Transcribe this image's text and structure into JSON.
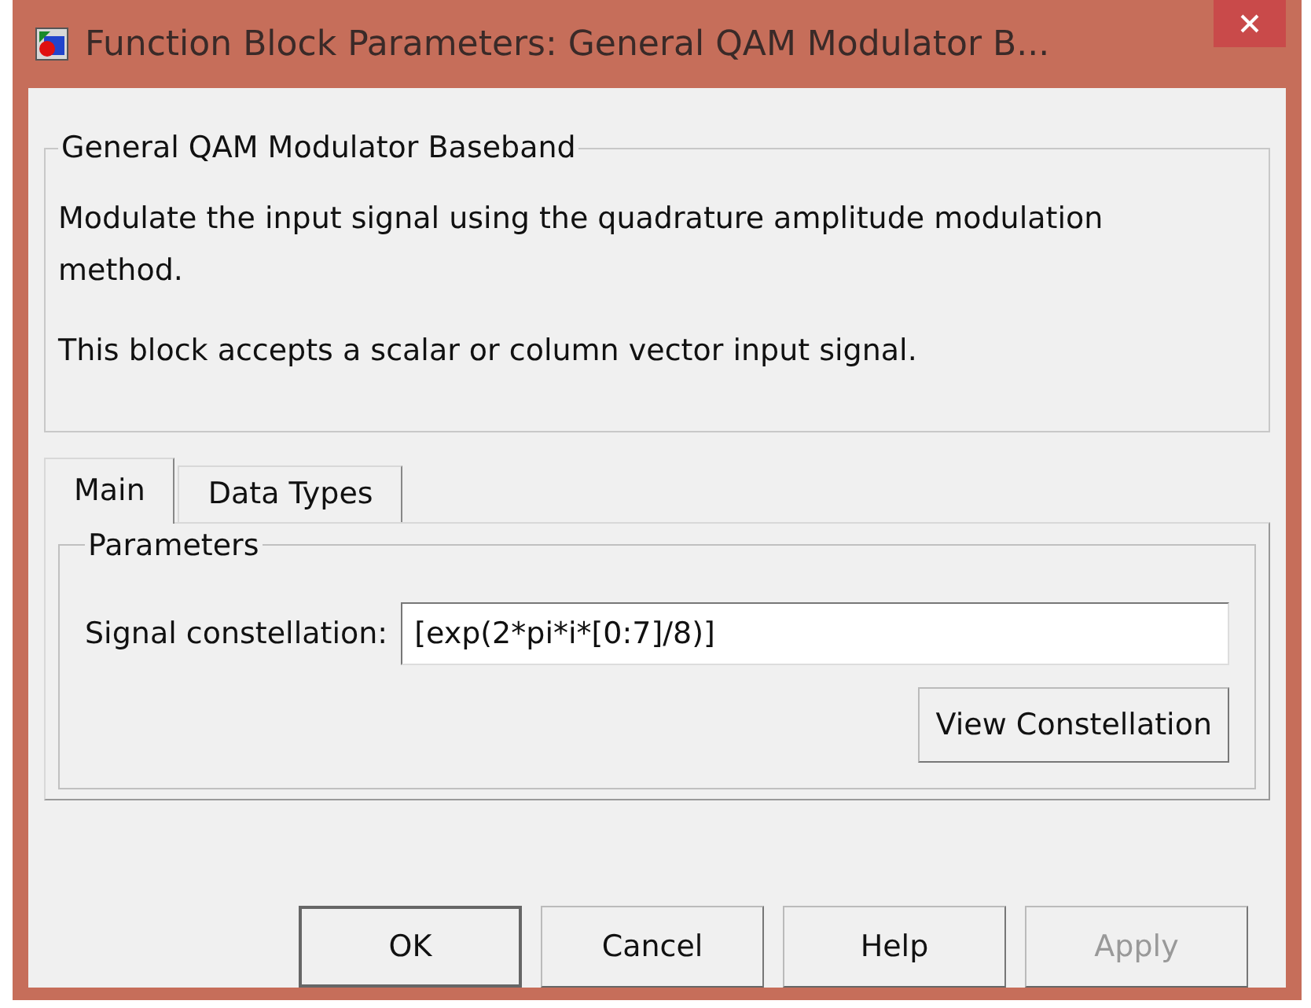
{
  "window": {
    "title": "Function Block Parameters: General QAM Modulator B..."
  },
  "description": {
    "title": "General QAM Modulator Baseband",
    "paragraphs": [
      "Modulate the input signal using the quadrature amplitude modulation method.",
      "This block accepts a scalar or column vector input signal."
    ]
  },
  "tabs": [
    {
      "label": "Main",
      "selected": true
    },
    {
      "label": "Data Types",
      "selected": false
    }
  ],
  "parameters": {
    "title": "Parameters",
    "fields": [
      {
        "label": "Signal constellation:",
        "value": "[exp(2*pi*i*[0:7]/8)]"
      }
    ],
    "action": "View Constellation"
  },
  "buttons": [
    {
      "label": "OK",
      "default": true,
      "disabled": false
    },
    {
      "label": "Cancel",
      "default": false,
      "disabled": false
    },
    {
      "label": "Help",
      "default": false,
      "disabled": false
    },
    {
      "label": "Apply",
      "default": false,
      "disabled": true
    }
  ]
}
